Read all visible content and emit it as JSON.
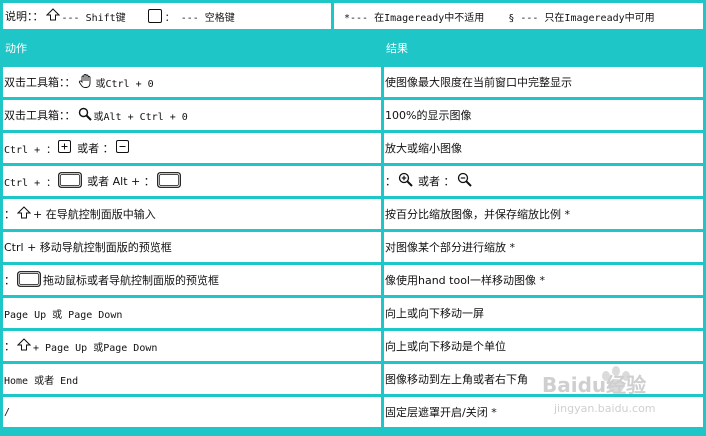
{
  "legend": {
    "label": "说明：：",
    "shift_text": "--- Shift键",
    "space_text": "： --- 空格键",
    "star_text": "*--- 在Imageready中不适用",
    "section_text": "§ --- 只在Imageready中可用"
  },
  "header": {
    "action": "动作",
    "result": "结果"
  },
  "rows": [
    {
      "a1": "双击工具箱：：",
      "a2": "或Ctrl + 0",
      "result": "使图像最大限度在当前窗口中完整显示"
    },
    {
      "a1": "双击工具箱：：",
      "a2": "或Alt + Ctrl + 0",
      "result": "100%的显示图像"
    },
    {
      "a1": "Ctrl + ：",
      "a2": "或者 ：",
      "result": "放大或缩小图像"
    },
    {
      "a1": "Ctrl + ：",
      "a2": "或者 Alt + ：",
      "result_a": "：",
      "result_b": "或者 ："
    },
    {
      "a1": "：",
      "a2": "+ 在导航控制面版中输入",
      "result": "按百分比缩放图像，并保存缩放比例 *"
    },
    {
      "a1": "Ctrl + 移动导航控制面版的预览框",
      "result": "对图像某个部分进行缩放 *"
    },
    {
      "a1": "：",
      "a2": "拖动鼠标或者导航控制面版的预览框",
      "result": "像使用hand tool一样移动图像 *"
    },
    {
      "a1": "Page Up 或 Page Down",
      "result": "向上或向下移动一屏"
    },
    {
      "a1": "：",
      "a2": "+ Page Up 或Page Down",
      "result": "向上或向下移动是个单位"
    },
    {
      "a1": "Home 或者 End",
      "result": "图像移动到左上角或者右下角"
    },
    {
      "a1": "/",
      "result": "固定层遮罩开启/关闭 *"
    }
  ],
  "watermark": {
    "brand": "Baidu经验",
    "url": "jingyan.baidu.com"
  }
}
